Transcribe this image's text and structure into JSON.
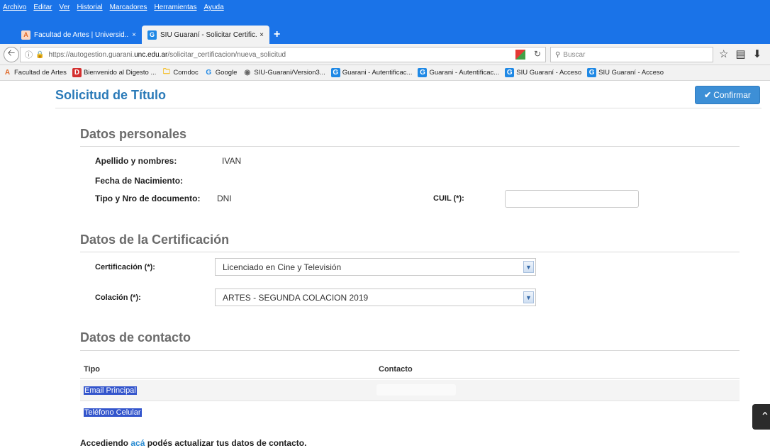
{
  "menu": [
    "Archivo",
    "Editar",
    "Ver",
    "Historial",
    "Marcadores",
    "Herramientas",
    "Ayuda"
  ],
  "tabs": [
    {
      "label": "Facultad de Artes | Universid...",
      "icon": "facultad-favicon",
      "close": "×"
    },
    {
      "label": "SIU Guaraní - Solicitar Certific...",
      "icon": "guarani-favicon",
      "close": "×"
    }
  ],
  "newtab": "+",
  "url": {
    "prefix": "https://autogestion.guarani.",
    "domain": "unc.edu.ar",
    "path": "/solicitar_certificacion/nueva_solicitud"
  },
  "search": {
    "placeholder": "Buscar"
  },
  "bookmarks": [
    {
      "label": "Facultad de Artes",
      "icon": "facultad-favicon"
    },
    {
      "label": "Bienvenido al Digesto ...",
      "icon": "digesto-favicon"
    },
    {
      "label": "Comdoc",
      "icon": "folder-icon"
    },
    {
      "label": "Google",
      "icon": "google-favicon"
    },
    {
      "label": "SIU-Guarani/Version3...",
      "icon": "globe-icon"
    },
    {
      "label": "Guarani - Autentificac...",
      "icon": "guarani-favicon"
    },
    {
      "label": "Guarani - Autentificac...",
      "icon": "guarani-favicon"
    },
    {
      "label": "SIU Guaraní - Acceso",
      "icon": "guarani-favicon"
    },
    {
      "label": "SIU Guaraní - Acceso",
      "icon": "guarani-favicon"
    }
  ],
  "page": {
    "title": "Solicitud de Título",
    "confirm_label": "Confirmar"
  },
  "personal": {
    "heading": "Datos personales",
    "name_label": "Apellido y nombres:",
    "name_value": "IVAN",
    "birth_label": "Fecha de Nacimiento:",
    "doc_label": "Tipo y Nro de documento:",
    "doc_value": "DNI",
    "cuil_label": "CUIL (*):",
    "cuil_value": ""
  },
  "certification": {
    "heading": "Datos de la Certificación",
    "cert_label": "Certificación (*):",
    "cert_value": "Licenciado en Cine y Televisión",
    "colacion_label": "Colación (*):",
    "colacion_value": "ARTES - SEGUNDA COLACION 2019"
  },
  "contact": {
    "heading": "Datos de contacto",
    "col_tipo": "Tipo",
    "col_contacto": "Contacto",
    "rows": [
      {
        "tipo": "Email Principal",
        "contacto": ""
      },
      {
        "tipo": "Teléfono Celular",
        "contacto": ""
      }
    ],
    "footer_pre": "Accediendo ",
    "footer_link": "acá",
    "footer_post": " podés actualizar tus datos de contacto."
  },
  "colors": {
    "accent": "#2a7ab8",
    "button": "#3d8fd6",
    "browser": "#1a73e8",
    "selection": "#3355cc"
  }
}
